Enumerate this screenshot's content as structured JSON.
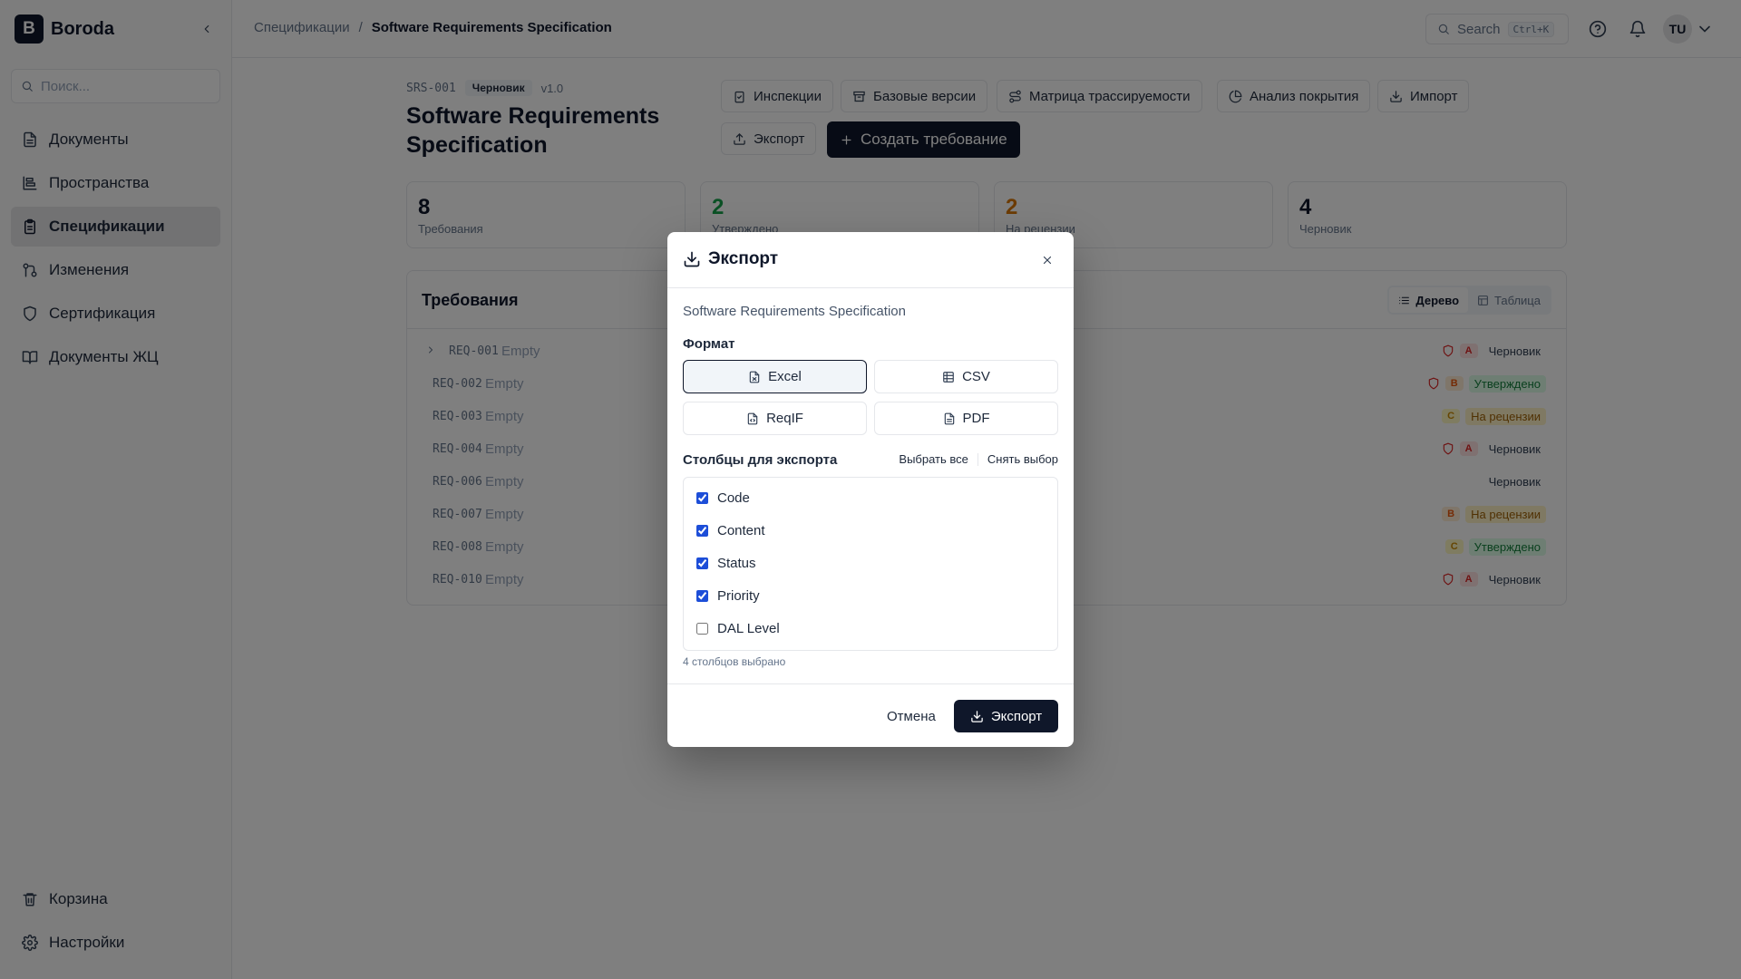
{
  "app": {
    "logo_letter": "B",
    "name": "Boroda"
  },
  "sidebar": {
    "search_placeholder": "Поиск...",
    "items": [
      {
        "label": "Документы",
        "icon": "document-icon"
      },
      {
        "label": "Пространства",
        "icon": "workspaces-icon"
      },
      {
        "label": "Спецификации",
        "icon": "clipboard-icon",
        "active": true
      },
      {
        "label": "Изменения",
        "icon": "git-branch-icon"
      },
      {
        "label": "Сертификация",
        "icon": "shield-icon"
      },
      {
        "label": "Документы ЖЦ",
        "icon": "book-icon"
      }
    ],
    "bottom_items": [
      {
        "label": "Корзина",
        "icon": "trash-icon"
      },
      {
        "label": "Настройки",
        "icon": "gear-icon"
      }
    ]
  },
  "topbar": {
    "breadcrumb": [
      "Спецификации",
      "/",
      "Software Requirements Specification"
    ],
    "search_label": "Search",
    "search_shortcut": "Ctrl+K",
    "avatar_initials": "TU"
  },
  "doc": {
    "code": "SRS-001",
    "status": "Черновик",
    "version": "v1.0",
    "title": "Software Requirements Specification"
  },
  "toolbar": {
    "inspections": "Инспекции",
    "baselines": "Базовые версии",
    "trace_matrix": "Матрица трассируемости",
    "coverage": "Анализ покрытия",
    "import": "Импорт",
    "export": "Экспорт",
    "create_req": "Создать требование"
  },
  "stats": [
    {
      "value": "8",
      "label": "Требования",
      "color": "#0f172a"
    },
    {
      "value": "2",
      "label": "Утверждено",
      "color": "#16a34a"
    },
    {
      "value": "2",
      "label": "На рецензии",
      "color": "#d97706"
    },
    {
      "value": "4",
      "label": "Черновик",
      "color": "#0f172a"
    }
  ],
  "requirements": {
    "title": "Требования",
    "view_tree": "Дерево",
    "view_table": "Таблица",
    "rows": [
      {
        "code": "REQ-001",
        "content": "Empty",
        "shield": true,
        "level": "A",
        "status": "Черновик",
        "status_kind": "draft",
        "expandable": true
      },
      {
        "code": "REQ-002",
        "content": "Empty",
        "shield": true,
        "level": "B",
        "status": "Утверждено",
        "status_kind": "approved"
      },
      {
        "code": "REQ-003",
        "content": "Empty",
        "shield": false,
        "level": "C",
        "status": "На рецензии",
        "status_kind": "review"
      },
      {
        "code": "REQ-004",
        "content": "Empty",
        "shield": true,
        "level": "A",
        "status": "Черновик",
        "status_kind": "draft"
      },
      {
        "code": "REQ-006",
        "content": "Empty",
        "shield": false,
        "level": "",
        "status": "Черновик",
        "status_kind": "draft"
      },
      {
        "code": "REQ-007",
        "content": "Empty",
        "shield": false,
        "level": "B",
        "status": "На рецензии",
        "status_kind": "review"
      },
      {
        "code": "REQ-008",
        "content": "Empty",
        "shield": false,
        "level": "C",
        "status": "Утверждено",
        "status_kind": "approved"
      },
      {
        "code": "REQ-010",
        "content": "Empty",
        "shield": true,
        "level": "A",
        "status": "Черновик",
        "status_kind": "draft"
      }
    ]
  },
  "modal": {
    "title": "Экспорт",
    "doc_name": "Software Requirements Specification",
    "format_label": "Формат",
    "formats": [
      {
        "label": "Excel",
        "selected": true
      },
      {
        "label": "CSV",
        "selected": false
      },
      {
        "label": "ReqIF",
        "selected": false
      },
      {
        "label": "PDF",
        "selected": false
      }
    ],
    "columns_label": "Столбцы для экспорта",
    "select_all": "Выбрать все",
    "deselect": "Снять выбор",
    "columns": [
      {
        "label": "Code",
        "checked": true
      },
      {
        "label": "Content",
        "checked": true
      },
      {
        "label": "Status",
        "checked": true
      },
      {
        "label": "Priority",
        "checked": true
      },
      {
        "label": "DAL Level",
        "checked": false
      }
    ],
    "selected_count": "4 столбцов выбрано",
    "cancel": "Отмена",
    "export": "Экспорт"
  },
  "colors": {
    "primary": "#0f172a",
    "approved_bg": "#dcfce7",
    "approved_fg": "#15803d",
    "review_bg": "#fef3c7",
    "review_fg": "#a16207",
    "level_a_bg": "#fee2e2",
    "level_a_fg": "#dc2626",
    "level_b_bg": "#ffedd5",
    "level_b_fg": "#ea580c",
    "level_c_bg": "#fef9c3",
    "level_c_fg": "#ca8a04",
    "shield": "#dc2626"
  }
}
